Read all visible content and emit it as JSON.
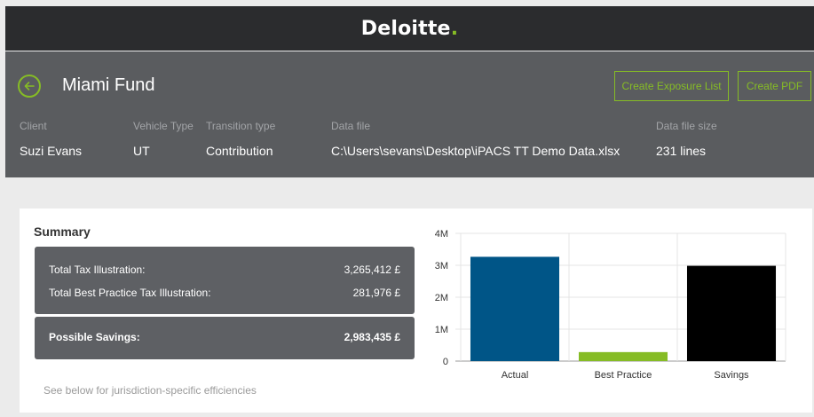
{
  "brand": {
    "name": "Deloitte",
    "dot": ".",
    "accent_color": "#86bc25"
  },
  "header": {
    "back_icon": "arrow-left-circle-icon",
    "title": "Miami Fund",
    "buttons": {
      "exposure": "Create Exposure List",
      "pdf": "Create PDF"
    },
    "meta": {
      "client_label": "Client",
      "client_value": "Suzi Evans",
      "vehicle_label": "Vehicle Type",
      "vehicle_value": "UT",
      "transition_label": "Transition type",
      "transition_value": "Contribution",
      "datafile_label": "Data file",
      "datafile_value": "C:\\Users\\sevans\\Desktop\\iPACS TT Demo Data.xlsx",
      "size_label": "Data file size",
      "size_value": "231 lines"
    }
  },
  "summary": {
    "title": "Summary",
    "rows": [
      {
        "label": "Total Tax Illustration:",
        "value": "3,265,412 £"
      },
      {
        "label": "Total Best Practice Tax Illustration:",
        "value": "281,976 £"
      }
    ],
    "savings": {
      "label": "Possible Savings:",
      "value": "2,983,435 £"
    },
    "footnote": "See below for jurisdiction-specific efficiencies"
  },
  "chart_data": {
    "type": "bar",
    "categories": [
      "Actual",
      "Best Practice",
      "Savings"
    ],
    "values": [
      3265412,
      281976,
      2983435
    ],
    "colors": [
      "#005587",
      "#86bc25",
      "#000000"
    ],
    "ylim": [
      0,
      4000000
    ],
    "yticks": [
      0,
      1000000,
      2000000,
      3000000,
      4000000
    ],
    "ytick_labels": [
      "0",
      "1M",
      "2M",
      "3M",
      "4M"
    ],
    "grid": true,
    "legend": "none"
  }
}
